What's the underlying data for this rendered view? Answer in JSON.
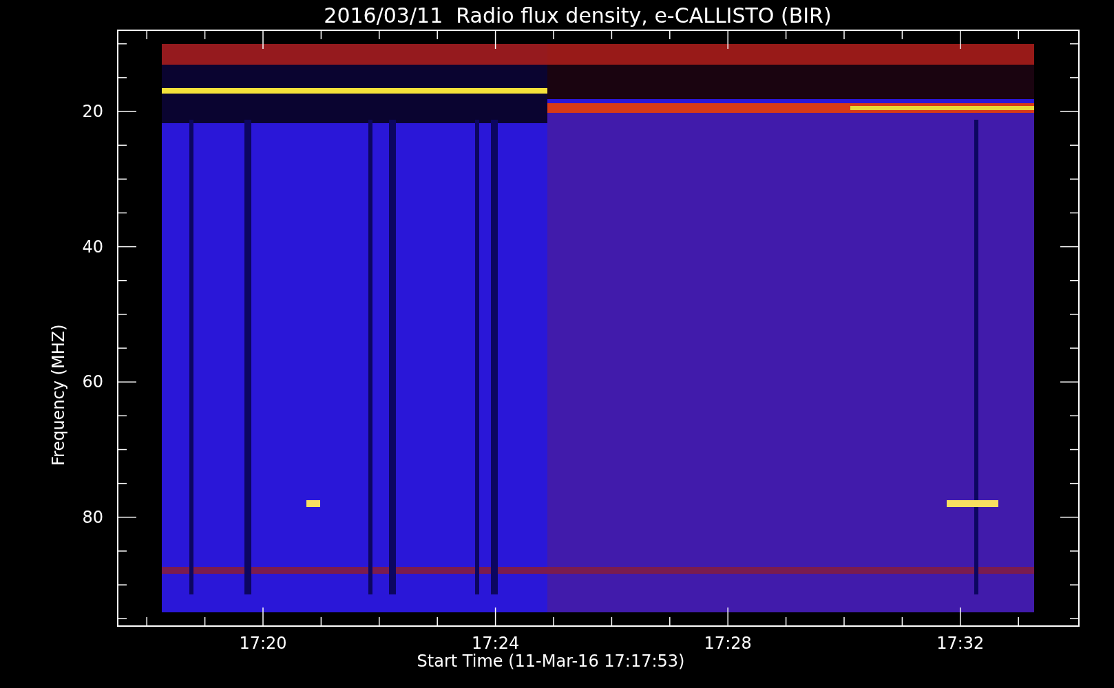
{
  "title": "2016/03/11  Radio flux density, e-CALLISTO (BIR)",
  "y_axis": {
    "label": "Frequency (MHZ)",
    "ticks": [
      "20",
      "40",
      "60",
      "80"
    ]
  },
  "x_axis": {
    "label": "Start Time (11-Mar-16 17:17:53)",
    "ticks": [
      "17:20",
      "17:24",
      "17:28",
      "17:32"
    ]
  }
}
